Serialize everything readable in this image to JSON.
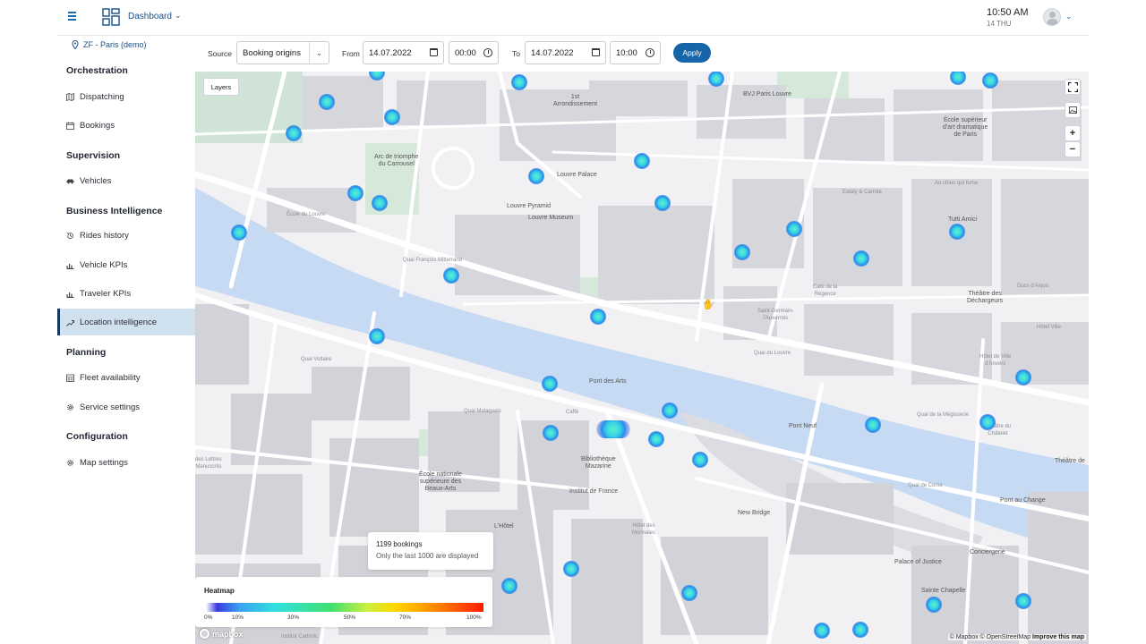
{
  "header": {
    "dashboard_label": "Dashboard",
    "time": "10:50 AM",
    "date": "14 THU"
  },
  "sidebar": {
    "tenant": "ZF - Paris (demo)",
    "sections": [
      {
        "title": "Orchestration",
        "items": [
          {
            "label": "Dispatching",
            "icon": "map-icon"
          },
          {
            "label": "Bookings",
            "icon": "calendar-icon"
          }
        ]
      },
      {
        "title": "Supervision",
        "items": [
          {
            "label": "Vehicles",
            "icon": "car-icon"
          }
        ]
      },
      {
        "title": "Business Intelligence",
        "items": [
          {
            "label": "Rides history",
            "icon": "history-icon"
          },
          {
            "label": "Vehicle KPIs",
            "icon": "chart-icon"
          },
          {
            "label": "Traveler KPIs",
            "icon": "chart-icon"
          },
          {
            "label": "Location intelligence",
            "icon": "analytics-icon",
            "active": true
          }
        ]
      },
      {
        "title": "Planning",
        "items": [
          {
            "label": "Fleet availability",
            "icon": "grid-calendar-icon"
          },
          {
            "label": "Service settings",
            "icon": "gear-icon"
          }
        ]
      },
      {
        "title": "Configuration",
        "items": [
          {
            "label": "Map settings",
            "icon": "gear-icon"
          }
        ]
      }
    ]
  },
  "filters": {
    "source_label": "Source",
    "source_value": "Booking origins",
    "from_label": "From",
    "from_date": "14.07.2022",
    "from_time": "00:00",
    "to_label": "To",
    "to_date": "14.07.2022",
    "to_time": "10:00",
    "apply_label": "Apply"
  },
  "map": {
    "layers_label": "Layers",
    "controls": [
      "fullscreen-icon",
      "image-icon",
      "zoom-in-icon",
      "zoom-out-icon"
    ],
    "zoom_in": "+",
    "zoom_out": "−",
    "tooltip_count": "1199 bookings",
    "tooltip_note": "Only the last 1000 are displayed",
    "legend_title": "Heatmap",
    "legend_ticks": [
      "0%",
      "10%",
      "30%",
      "50%",
      "70%",
      "100%"
    ],
    "mapbox_logo": "mapbox",
    "attribution": "© Mapbox © OpenStreetMap",
    "improve": "Improve this map",
    "places": [
      {
        "key": "arr1",
        "text": "1st\nArrondissement"
      },
      {
        "key": "bvj",
        "text": "BVJ Paris Louvre"
      },
      {
        "key": "ecole_art",
        "text": "École supérieur\nd'art dramatique\nde Paris"
      },
      {
        "key": "arc",
        "text": "Arc de triomphe\ndu Carrousel"
      },
      {
        "key": "louvre_palace",
        "text": "Louvre Palace"
      },
      {
        "key": "louvre_pyr",
        "text": "Louvre Pyramid"
      },
      {
        "key": "louvre_museum",
        "text": "Louvre Museum"
      },
      {
        "key": "ecole_louvre",
        "text": "École du Louvre"
      },
      {
        "key": "eatalo",
        "text": "Eataly & Carrola"
      },
      {
        "key": "chien",
        "text": "Au chien qui fume"
      },
      {
        "key": "tutti",
        "text": "Tutti Amici"
      },
      {
        "key": "quai_fr",
        "text": "Quai François Mitterrand"
      },
      {
        "key": "cafe",
        "text": "Café de la\nRégence"
      },
      {
        "key": "saintg",
        "text": "Saint-Germain-\nl'Auxerrois"
      },
      {
        "key": "theatre_dech",
        "text": "Théâtre des\nDéchargeurs"
      },
      {
        "key": "ducs",
        "text": "Ducs d'Anjou"
      },
      {
        "key": "quai_louvre",
        "text": "Quai du Louvre"
      },
      {
        "key": "hotel_ville",
        "text": "Hôtel de Ville\nd'Anvers"
      },
      {
        "key": "quai_voltaire",
        "text": "Quai Voltaire"
      },
      {
        "key": "pont_arts",
        "text": "Pont des Arts"
      },
      {
        "key": "caffe",
        "text": "Caffè"
      },
      {
        "key": "pont_neuf",
        "text": "Pont Neuf"
      },
      {
        "key": "theatre_ch",
        "text": "Théâtre du\nChâtelet"
      },
      {
        "key": "theatre_r",
        "text": "Théâtre de"
      },
      {
        "key": "ecole_beaux",
        "text": "École nationale\nsupérieure des\nBeaux-Arts"
      },
      {
        "key": "bib",
        "text": "Bibliothèque\nMazarine"
      },
      {
        "key": "institut",
        "text": "Institut de France"
      },
      {
        "key": "new_bridge",
        "text": "New Bridge"
      },
      {
        "key": "pont_change",
        "text": "Pont au Change"
      },
      {
        "key": "lhotel",
        "text": "L'Hôtel"
      },
      {
        "key": "monnaies",
        "text": "Hôtel des\nMonnaies"
      },
      {
        "key": "conciergerie",
        "text": "Conciergerie"
      },
      {
        "key": "palace_justice",
        "text": "Palace of Justice"
      },
      {
        "key": "sainte",
        "text": "Sainte Chapelle"
      },
      {
        "key": "lettres",
        "text": "des Lettres\nManuscrits"
      },
      {
        "key": "hotel_r",
        "text": "Hôtel Ville"
      },
      {
        "key": "quai_conti",
        "text": "Quai Malaquais"
      },
      {
        "key": "quai_megisserie",
        "text": "Quai de la Mégisserie"
      },
      {
        "key": "quai_corse",
        "text": "Quai de Corse"
      },
      {
        "key": "catholic",
        "text": "Institut Catholic"
      }
    ]
  }
}
